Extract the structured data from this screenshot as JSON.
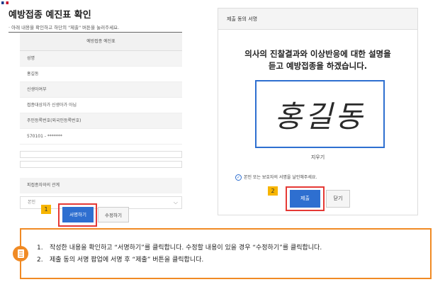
{
  "left": {
    "title": "예방접종 예진표 확인",
    "subtitle": "· 아래 내용을 확인하고 하단의 \"제출\" 버튼을 눌러주세요.",
    "form_header": "예방접종 예진표",
    "rows": [
      "성명",
      "홍길동",
      "신생아여부",
      "접종대상자가 신생아가 아님",
      "주민등록번호(외국인등록번호)",
      "570101 - *******"
    ],
    "relation_label": "피접종자와의 관계",
    "relation_value": "본인",
    "sign_button": "서명하기",
    "edit_button": "수정하기",
    "step_badge": "1"
  },
  "modal": {
    "title": "제출 동의 서명",
    "message_line1": "의사의 진찰결과와 이상반응에 대한 설명을",
    "message_line2": "듣고 예방접종을 하겠습니다.",
    "signature": "홍길동",
    "erase_label": "지우기",
    "notice": "본인 또는 보호자의 서명을 날인해주세요.",
    "submit_button": "제출",
    "close_button": "닫기",
    "step_badge": "2"
  },
  "guide": {
    "items": [
      {
        "num": "1.",
        "text": "작성한 내용을 확인하고 “서명하기”를 클릭합니다. 수정할 내용이 있을 경우 “수정하기”를 클릭합니다."
      },
      {
        "num": "2.",
        "text": "제출 동의 서명 팝업에 서명 후 “제출” 버튼을 클릭합니다."
      }
    ]
  },
  "colors": {
    "accent": "#2e6fd0",
    "highlight": "#e53935",
    "badge": "#f7b500",
    "guide_border": "#f08a24"
  }
}
